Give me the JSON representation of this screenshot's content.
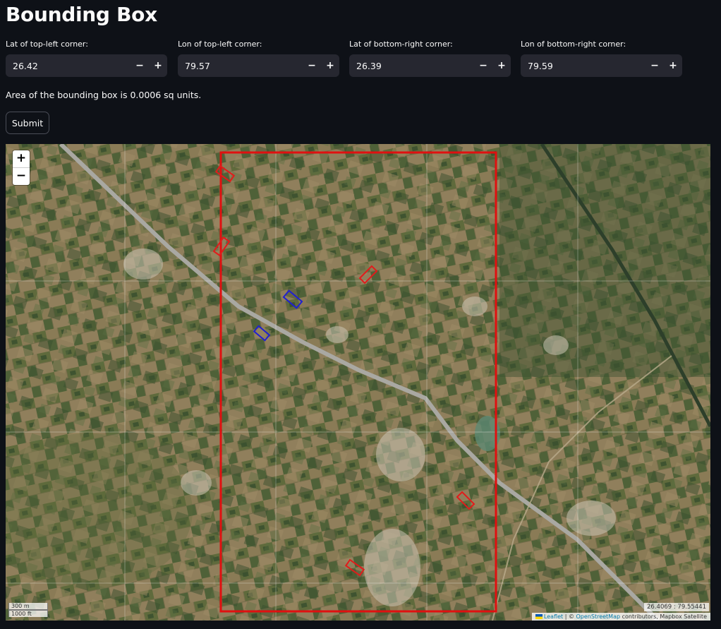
{
  "page": {
    "title": "Bounding Box"
  },
  "inputs": [
    {
      "label": "Lat of top-left corner:",
      "value": "26.42"
    },
    {
      "label": "Lon of top-left corner:",
      "value": "79.57"
    },
    {
      "label": "Lat of bottom-right corner:",
      "value": "26.39"
    },
    {
      "label": "Lon of bottom-right corner:",
      "value": "79.59"
    }
  ],
  "stepper": {
    "minus": "−",
    "plus": "+"
  },
  "area_text": "Area of the bounding box is 0.0006 sq units.",
  "submit_label": "Submit",
  "map": {
    "zoom_in": "+",
    "zoom_out": "−",
    "scale_metric": "300 m",
    "scale_imperial": "1000 ft",
    "cursor_coords": "26.4069 : 79.55441",
    "attribution": {
      "leaflet": "Leaflet",
      "separator": " | © ",
      "osm": "OpenStreetMap",
      "rest": " contributors, Mapbox Satellite"
    },
    "colors": {
      "bounding_box": "#e01010",
      "red_markers": "#e21b1b",
      "blue_markers": "#2020d0",
      "road": "#a9a8a2"
    }
  }
}
